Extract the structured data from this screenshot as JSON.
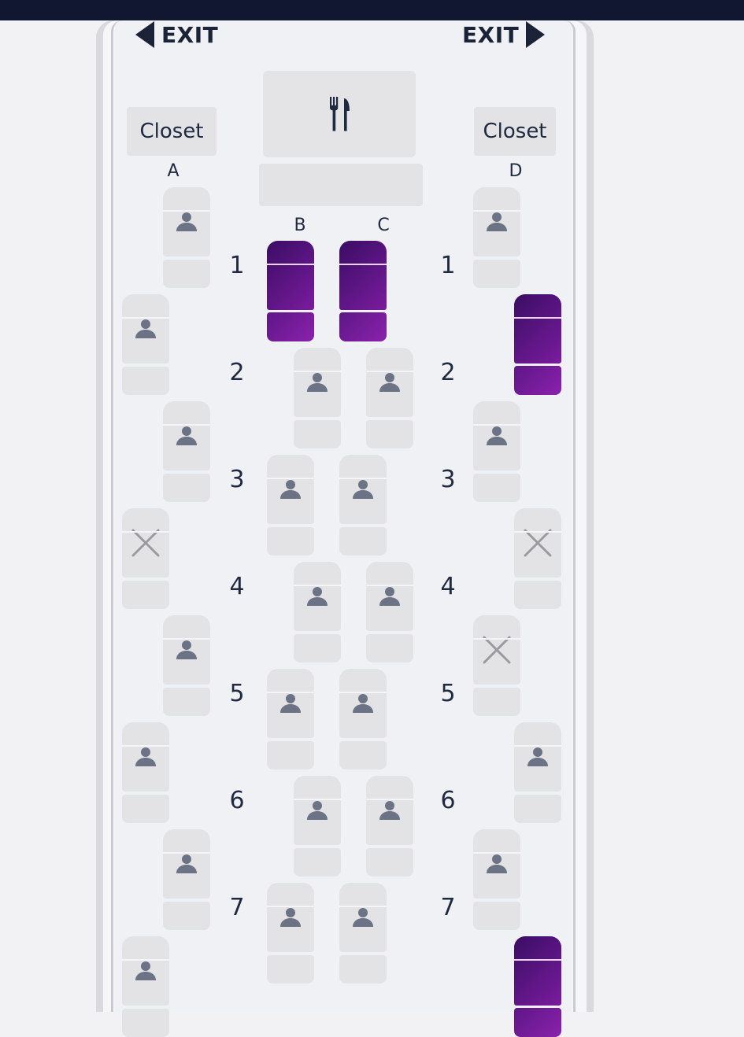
{
  "header": {
    "exit_left": "EXIT",
    "exit_right": "EXIT"
  },
  "facilities": {
    "closet_left": "Closet",
    "closet_right": "Closet",
    "galley_icon": "fork-knife-icon"
  },
  "column_letters": [
    "A",
    "B",
    "C",
    "D"
  ],
  "row_numbers": [
    "1",
    "2",
    "3",
    "4",
    "5",
    "6",
    "7"
  ],
  "legend_colors": {
    "selected": "#5a1484",
    "available": "#e3e3e6",
    "occupied_icon": "#6b7384",
    "unavailable_icon": "#9a9aa0"
  },
  "seats": [
    {
      "id": "1A",
      "status": "occupied"
    },
    {
      "id": "1B",
      "status": "selected"
    },
    {
      "id": "1C",
      "status": "selected"
    },
    {
      "id": "1D",
      "status": "occupied"
    },
    {
      "id": "2A",
      "status": "occupied"
    },
    {
      "id": "2B",
      "status": "occupied"
    },
    {
      "id": "2C",
      "status": "occupied"
    },
    {
      "id": "2D",
      "status": "selected"
    },
    {
      "id": "3A",
      "status": "occupied"
    },
    {
      "id": "3B",
      "status": "occupied"
    },
    {
      "id": "3C",
      "status": "occupied"
    },
    {
      "id": "3D",
      "status": "occupied"
    },
    {
      "id": "4A",
      "status": "unavailable"
    },
    {
      "id": "4B",
      "status": "occupied"
    },
    {
      "id": "4C",
      "status": "occupied"
    },
    {
      "id": "4D",
      "status": "unavailable"
    },
    {
      "id": "5A",
      "status": "occupied"
    },
    {
      "id": "5B",
      "status": "occupied"
    },
    {
      "id": "5C",
      "status": "occupied"
    },
    {
      "id": "5D",
      "status": "unavailable"
    },
    {
      "id": "6A",
      "status": "occupied"
    },
    {
      "id": "6B",
      "status": "occupied"
    },
    {
      "id": "6C",
      "status": "occupied"
    },
    {
      "id": "6D",
      "status": "occupied"
    },
    {
      "id": "7A",
      "status": "occupied"
    },
    {
      "id": "7B",
      "status": "occupied"
    },
    {
      "id": "7C",
      "status": "occupied"
    },
    {
      "id": "7D",
      "status": "occupied"
    },
    {
      "id": "8A",
      "status": "occupied"
    },
    {
      "id": "8D",
      "status": "selected"
    }
  ]
}
